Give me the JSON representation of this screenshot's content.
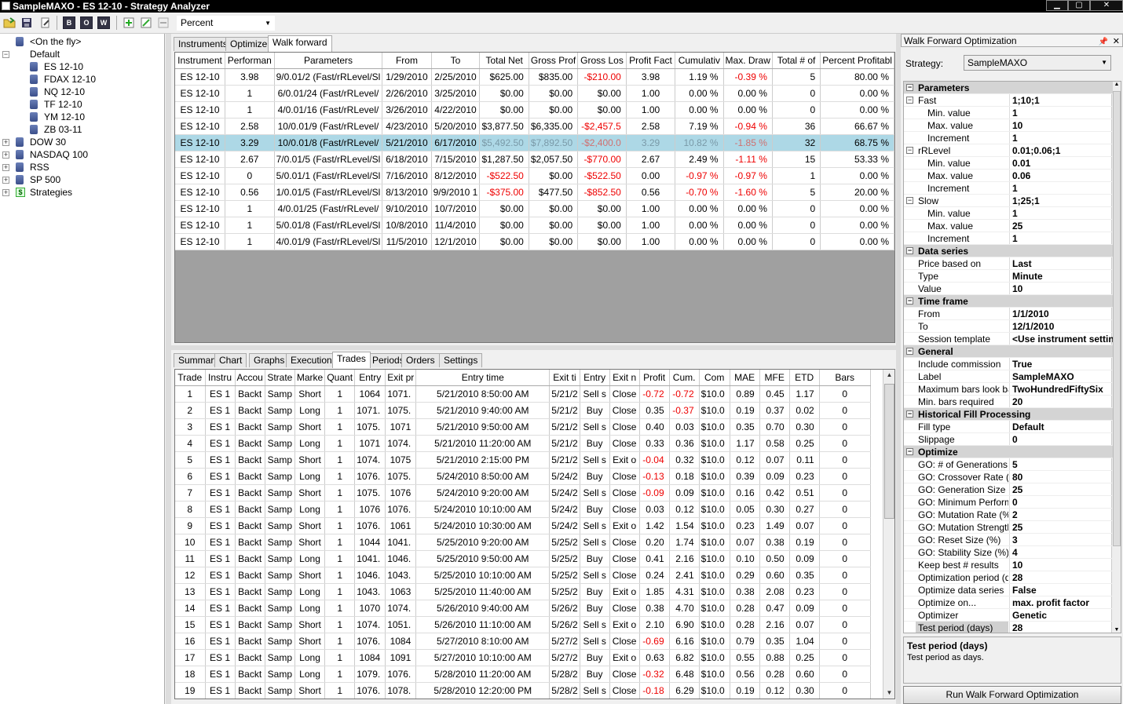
{
  "window": {
    "title": "SampleMAXO - ES 12-10 - Strategy Analyzer",
    "min": "▁",
    "max": "▢",
    "close": "✕"
  },
  "toolbar": {
    "buttons": [
      "open-folder-icon",
      "save-icon",
      "edit-icon",
      "backtest-icon",
      "optimize-icon",
      "walkforward-icon",
      "add-icon",
      "edit-item-icon",
      "remove-icon"
    ],
    "box_b": "B",
    "box_o": "O",
    "box_w": "W",
    "display_unit": "Percent"
  },
  "tree": {
    "items": [
      {
        "label": "<On the fly>",
        "level": 1,
        "icon": "db"
      },
      {
        "label": "Default",
        "level": 0,
        "icon": "none",
        "expander": "−"
      },
      {
        "label": "ES 12-10",
        "level": 2,
        "icon": "db",
        "selected": true
      },
      {
        "label": "FDAX 12-10",
        "level": 2,
        "icon": "db"
      },
      {
        "label": "NQ 12-10",
        "level": 2,
        "icon": "db"
      },
      {
        "label": "TF 12-10",
        "level": 2,
        "icon": "db"
      },
      {
        "label": "YM 12-10",
        "level": 2,
        "icon": "db"
      },
      {
        "label": "ZB 03-11",
        "level": 2,
        "icon": "db"
      },
      {
        "label": "DOW 30",
        "level": 1,
        "icon": "db",
        "expander": "+"
      },
      {
        "label": "NASDAQ 100",
        "level": 1,
        "icon": "db",
        "expander": "+"
      },
      {
        "label": "RSS",
        "level": 1,
        "icon": "db",
        "expander": "+"
      },
      {
        "label": "SP 500",
        "level": 1,
        "icon": "db",
        "expander": "+"
      },
      {
        "label": "Strategies",
        "level": 1,
        "icon": "dollar",
        "expander": "+"
      }
    ]
  },
  "top_tabs": [
    "Instruments",
    "Optimizer",
    "Walk forward"
  ],
  "top_active": 2,
  "wf_table": {
    "columns": [
      "Instrument",
      "Performan",
      "Parameters",
      "From",
      "To",
      "Total Net",
      "Gross Prof",
      "Gross Los",
      "Profit Fact",
      "Cumulativ",
      "Max. Draw",
      "Total # of",
      "Percent Profitabl"
    ],
    "rows": [
      [
        "ES 12-10",
        "3.98",
        "9/0.01/2 (Fast/rRLevel/Sl",
        "1/29/2010",
        "2/25/2010",
        "$625.00",
        "$835.00",
        "-$210.00",
        "3.98",
        "1.19 %",
        "-0.39 %",
        "5",
        "80.00 %"
      ],
      [
        "ES 12-10",
        "1",
        "6/0.01/24 (Fast/rRLevel/",
        "2/26/2010",
        "3/25/2010",
        "$0.00",
        "$0.00",
        "$0.00",
        "1.00",
        "0.00 %",
        "0.00 %",
        "0",
        "0.00 %"
      ],
      [
        "ES 12-10",
        "1",
        "4/0.01/16 (Fast/rRLevel/",
        "3/26/2010",
        "4/22/2010",
        "$0.00",
        "$0.00",
        "$0.00",
        "1.00",
        "0.00 %",
        "0.00 %",
        "0",
        "0.00 %"
      ],
      [
        "ES 12-10",
        "2.58",
        "10/0.01/9 (Fast/rRLevel/",
        "4/23/2010",
        "5/20/2010",
        "$3,877.50",
        "$6,335.00",
        "-$2,457.5",
        "2.58",
        "7.19 %",
        "-0.94 %",
        "36",
        "66.67 %"
      ],
      [
        "ES 12-10",
        "3.29",
        "10/0.01/8 (Fast/rRLevel/",
        "5/21/2010",
        "6/17/2010",
        "$5,492.50",
        "$7,892.50",
        "-$2,400.0",
        "3.29",
        "10.82 %",
        "-1.85 %",
        "32",
        "68.75 %"
      ],
      [
        "ES 12-10",
        "2.67",
        "7/0.01/5 (Fast/rRLevel/Sl",
        "6/18/2010",
        "7/15/2010",
        "$1,287.50",
        "$2,057.50",
        "-$770.00",
        "2.67",
        "2.49 %",
        "-1.11 %",
        "15",
        "53.33 %"
      ],
      [
        "ES 12-10",
        "0",
        "5/0.01/1 (Fast/rRLevel/Sl",
        "7/16/2010",
        "8/12/2010",
        "-$522.50",
        "$0.00",
        "-$522.50",
        "0.00",
        "-0.97 %",
        "-0.97 %",
        "1",
        "0.00 %"
      ],
      [
        "ES 12-10",
        "0.56",
        "1/0.01/5 (Fast/rRLevel/Sl",
        "8/13/2010",
        "9/9/2010 1",
        "-$375.00",
        "$477.50",
        "-$852.50",
        "0.56",
        "-0.70 %",
        "-1.60 %",
        "5",
        "20.00 %"
      ],
      [
        "ES 12-10",
        "1",
        "4/0.01/25 (Fast/rRLevel/",
        "9/10/2010",
        "10/7/2010",
        "$0.00",
        "$0.00",
        "$0.00",
        "1.00",
        "0.00 %",
        "0.00 %",
        "0",
        "0.00 %"
      ],
      [
        "ES 12-10",
        "1",
        "5/0.01/8 (Fast/rRLevel/Sl",
        "10/8/2010",
        "11/4/2010",
        "$0.00",
        "$0.00",
        "$0.00",
        "1.00",
        "0.00 %",
        "0.00 %",
        "0",
        "0.00 %"
      ],
      [
        "ES 12-10",
        "1",
        "4/0.01/9 (Fast/rRLevel/Sl",
        "11/5/2010",
        "12/1/2010",
        "$0.00",
        "$0.00",
        "$0.00",
        "1.00",
        "0.00 %",
        "0.00 %",
        "0",
        "0.00 %"
      ]
    ],
    "selected_row": 4
  },
  "bottom_tabs": [
    "Summary",
    "Chart",
    "Graphs",
    "Executions",
    "Trades",
    "Periods",
    "Orders",
    "Settings"
  ],
  "bottom_active": 4,
  "trades_table": {
    "columns": [
      "Trade",
      "Instru",
      "Accou",
      "Strate",
      "Marke",
      "Quant",
      "Entry",
      "Exit pr",
      "Entry time",
      "Exit ti",
      "Entry",
      "Exit n",
      "Profit",
      "Cum.",
      "Com",
      "MAE",
      "MFE",
      "ETD",
      "Bars"
    ],
    "rows": [
      [
        "1",
        "ES 1",
        "Backt",
        "Samp",
        "Short",
        "1",
        "1064",
        "1071.",
        "5/21/2010 8:50:00 AM",
        "5/21/2",
        "Sell s",
        "Close",
        "-0.72",
        "-0.72",
        "$10.0",
        "0.89",
        "0.45",
        "1.17",
        "0"
      ],
      [
        "2",
        "ES 1",
        "Backt",
        "Samp",
        "Long",
        "1",
        "1071.",
        "1075.",
        "5/21/2010 9:40:00 AM",
        "5/21/2",
        "Buy",
        "Close",
        "0.35",
        "-0.37",
        "$10.0",
        "0.19",
        "0.37",
        "0.02",
        "0"
      ],
      [
        "3",
        "ES 1",
        "Backt",
        "Samp",
        "Short",
        "1",
        "1075.",
        "1071",
        "5/21/2010 9:50:00 AM",
        "5/21/2",
        "Sell s",
        "Close",
        "0.40",
        "0.03",
        "$10.0",
        "0.35",
        "0.70",
        "0.30",
        "0"
      ],
      [
        "4",
        "ES 1",
        "Backt",
        "Samp",
        "Long",
        "1",
        "1071",
        "1074.",
        "5/21/2010 11:20:00 AM",
        "5/21/2",
        "Buy",
        "Close",
        "0.33",
        "0.36",
        "$10.0",
        "1.17",
        "0.58",
        "0.25",
        "0"
      ],
      [
        "5",
        "ES 1",
        "Backt",
        "Samp",
        "Short",
        "1",
        "1074.",
        "1075",
        "5/21/2010 2:15:00 PM",
        "5/21/2",
        "Sell s",
        "Exit o",
        "-0.04",
        "0.32",
        "$10.0",
        "0.12",
        "0.07",
        "0.11",
        "0"
      ],
      [
        "6",
        "ES 1",
        "Backt",
        "Samp",
        "Long",
        "1",
        "1076.",
        "1075.",
        "5/24/2010 8:50:00 AM",
        "5/24/2",
        "Buy",
        "Close",
        "-0.13",
        "0.18",
        "$10.0",
        "0.39",
        "0.09",
        "0.23",
        "0"
      ],
      [
        "7",
        "ES 1",
        "Backt",
        "Samp",
        "Short",
        "1",
        "1075.",
        "1076",
        "5/24/2010 9:20:00 AM",
        "5/24/2",
        "Sell s",
        "Close",
        "-0.09",
        "0.09",
        "$10.0",
        "0.16",
        "0.42",
        "0.51",
        "0"
      ],
      [
        "8",
        "ES 1",
        "Backt",
        "Samp",
        "Long",
        "1",
        "1076",
        "1076.",
        "5/24/2010 10:10:00 AM",
        "5/24/2",
        "Buy",
        "Close",
        "0.03",
        "0.12",
        "$10.0",
        "0.05",
        "0.30",
        "0.27",
        "0"
      ],
      [
        "9",
        "ES 1",
        "Backt",
        "Samp",
        "Short",
        "1",
        "1076.",
        "1061",
        "5/24/2010 10:30:00 AM",
        "5/24/2",
        "Sell s",
        "Exit o",
        "1.42",
        "1.54",
        "$10.0",
        "0.23",
        "1.49",
        "0.07",
        "0"
      ],
      [
        "10",
        "ES 1",
        "Backt",
        "Samp",
        "Short",
        "1",
        "1044",
        "1041.",
        "5/25/2010 9:20:00 AM",
        "5/25/2",
        "Sell s",
        "Close",
        "0.20",
        "1.74",
        "$10.0",
        "0.07",
        "0.38",
        "0.19",
        "0"
      ],
      [
        "11",
        "ES 1",
        "Backt",
        "Samp",
        "Long",
        "1",
        "1041.",
        "1046.",
        "5/25/2010 9:50:00 AM",
        "5/25/2",
        "Buy",
        "Close",
        "0.41",
        "2.16",
        "$10.0",
        "0.10",
        "0.50",
        "0.09",
        "0"
      ],
      [
        "12",
        "ES 1",
        "Backt",
        "Samp",
        "Short",
        "1",
        "1046.",
        "1043.",
        "5/25/2010 10:10:00 AM",
        "5/25/2",
        "Sell s",
        "Close",
        "0.24",
        "2.41",
        "$10.0",
        "0.29",
        "0.60",
        "0.35",
        "0"
      ],
      [
        "13",
        "ES 1",
        "Backt",
        "Samp",
        "Long",
        "1",
        "1043.",
        "1063",
        "5/25/2010 11:40:00 AM",
        "5/25/2",
        "Buy",
        "Exit o",
        "1.85",
        "4.31",
        "$10.0",
        "0.38",
        "2.08",
        "0.23",
        "0"
      ],
      [
        "14",
        "ES 1",
        "Backt",
        "Samp",
        "Long",
        "1",
        "1070",
        "1074.",
        "5/26/2010 9:40:00 AM",
        "5/26/2",
        "Buy",
        "Close",
        "0.38",
        "4.70",
        "$10.0",
        "0.28",
        "0.47",
        "0.09",
        "0"
      ],
      [
        "15",
        "ES 1",
        "Backt",
        "Samp",
        "Short",
        "1",
        "1074.",
        "1051.",
        "5/26/2010 11:10:00 AM",
        "5/26/2",
        "Sell s",
        "Exit o",
        "2.10",
        "6.90",
        "$10.0",
        "0.28",
        "2.16",
        "0.07",
        "0"
      ],
      [
        "16",
        "ES 1",
        "Backt",
        "Samp",
        "Short",
        "1",
        "1076.",
        "1084",
        "5/27/2010 8:10:00 AM",
        "5/27/2",
        "Sell s",
        "Close",
        "-0.69",
        "6.16",
        "$10.0",
        "0.79",
        "0.35",
        "1.04",
        "0"
      ],
      [
        "17",
        "ES 1",
        "Backt",
        "Samp",
        "Long",
        "1",
        "1084",
        "1091",
        "5/27/2010 10:10:00 AM",
        "5/27/2",
        "Buy",
        "Exit o",
        "0.63",
        "6.82",
        "$10.0",
        "0.55",
        "0.88",
        "0.25",
        "0"
      ],
      [
        "18",
        "ES 1",
        "Backt",
        "Samp",
        "Long",
        "1",
        "1079.",
        "1076.",
        "5/28/2010 11:20:00 AM",
        "5/28/2",
        "Buy",
        "Close",
        "-0.32",
        "6.48",
        "$10.0",
        "0.56",
        "0.28",
        "0.60",
        "0"
      ],
      [
        "19",
        "ES 1",
        "Backt",
        "Samp",
        "Short",
        "1",
        "1076.",
        "1078.",
        "5/28/2010 12:20:00 PM",
        "5/28/2",
        "Sell s",
        "Close",
        "-0.18",
        "6.29",
        "$10.0",
        "0.19",
        "0.12",
        "0.30",
        "0"
      ]
    ]
  },
  "right_panel": {
    "title": "Walk Forward Optimization",
    "strategy_label": "Strategy:",
    "strategy_value": "SampleMAXO",
    "properties": [
      {
        "kind": "cat",
        "name": "Parameters"
      },
      {
        "kind": "child",
        "name": "Fast",
        "value": "1;10;1",
        "exp": "−"
      },
      {
        "kind": "sub",
        "name": "Min. value",
        "value": "1"
      },
      {
        "kind": "sub",
        "name": "Max. value",
        "value": "10"
      },
      {
        "kind": "sub",
        "name": "Increment",
        "value": "1"
      },
      {
        "kind": "child",
        "name": "rRLevel",
        "value": "0.01;0.06;1",
        "exp": "−"
      },
      {
        "kind": "sub",
        "name": "Min. value",
        "value": "0.01"
      },
      {
        "kind": "sub",
        "name": "Max. value",
        "value": "0.06"
      },
      {
        "kind": "sub",
        "name": "Increment",
        "value": "1"
      },
      {
        "kind": "child",
        "name": "Slow",
        "value": "1;25;1",
        "exp": "−"
      },
      {
        "kind": "sub",
        "name": "Min. value",
        "value": "1"
      },
      {
        "kind": "sub",
        "name": "Max. value",
        "value": "25"
      },
      {
        "kind": "sub",
        "name": "Increment",
        "value": "1"
      },
      {
        "kind": "cat",
        "name": "Data series"
      },
      {
        "kind": "child",
        "name": "Price based on",
        "value": "Last"
      },
      {
        "kind": "child",
        "name": "Type",
        "value": "Minute"
      },
      {
        "kind": "child",
        "name": "Value",
        "value": "10"
      },
      {
        "kind": "cat",
        "name": "Time frame"
      },
      {
        "kind": "child",
        "name": "From",
        "value": "1/1/2010"
      },
      {
        "kind": "child",
        "name": "To",
        "value": "12/1/2010"
      },
      {
        "kind": "child",
        "name": "Session template",
        "value": "<Use instrument settings>"
      },
      {
        "kind": "cat",
        "name": "General"
      },
      {
        "kind": "child",
        "name": "Include commission",
        "value": "True"
      },
      {
        "kind": "child",
        "name": "Label",
        "value": "SampleMAXO"
      },
      {
        "kind": "child",
        "name": "Maximum bars look back",
        "value": "TwoHundredFiftySix"
      },
      {
        "kind": "child",
        "name": "Min. bars required",
        "value": "20"
      },
      {
        "kind": "cat",
        "name": "Historical Fill Processing"
      },
      {
        "kind": "child",
        "name": "Fill type",
        "value": "Default"
      },
      {
        "kind": "child",
        "name": "Slippage",
        "value": "0"
      },
      {
        "kind": "cat",
        "name": "Optimize"
      },
      {
        "kind": "child",
        "name": "GO: # of Generations",
        "value": "5"
      },
      {
        "kind": "child",
        "name": "GO: Crossover Rate (%)",
        "value": "80"
      },
      {
        "kind": "child",
        "name": "GO: Generation Size",
        "value": "25"
      },
      {
        "kind": "child",
        "name": "GO: Minimum Performance",
        "value": "0"
      },
      {
        "kind": "child",
        "name": "GO: Mutation Rate (%)",
        "value": "2"
      },
      {
        "kind": "child",
        "name": "GO: Mutation Strength",
        "value": "25"
      },
      {
        "kind": "child",
        "name": "GO: Reset Size (%)",
        "value": "3"
      },
      {
        "kind": "child",
        "name": "GO: Stability Size (%)",
        "value": "4"
      },
      {
        "kind": "child",
        "name": "Keep best # results",
        "value": "10"
      },
      {
        "kind": "child",
        "name": "Optimization period (days)",
        "value": "28"
      },
      {
        "kind": "child",
        "name": "Optimize data series",
        "value": "False"
      },
      {
        "kind": "child",
        "name": "Optimize on...",
        "value": "max. profit factor"
      },
      {
        "kind": "child",
        "name": "Optimizer",
        "value": "Genetic"
      },
      {
        "kind": "child",
        "name": "Test period (days)",
        "value": "28",
        "highlight": true
      }
    ],
    "help_title": "Test period (days)",
    "help_text": "Test period as days.",
    "run_button": "Run Walk Forward Optimization"
  },
  "colors": {
    "selected_row": "#add8e6",
    "negative": "#e00000",
    "category": "#d4d4d4"
  }
}
